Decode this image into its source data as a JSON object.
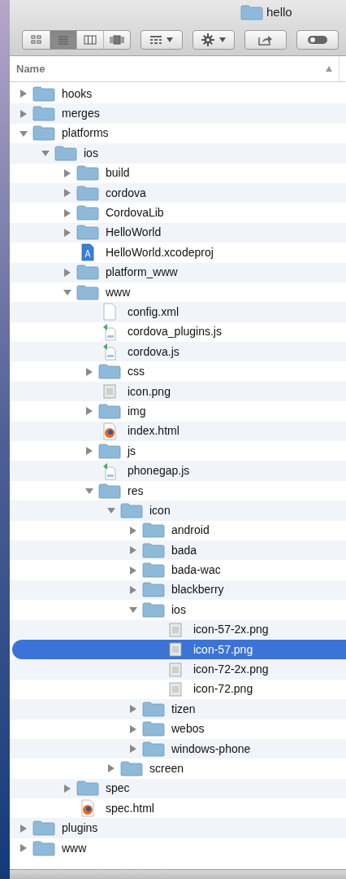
{
  "window": {
    "title": "hello"
  },
  "toolbar": {
    "view_modes": [
      {
        "kind": "icons",
        "selected": false
      },
      {
        "kind": "list",
        "selected": true
      },
      {
        "kind": "columns",
        "selected": false
      },
      {
        "kind": "coverflow",
        "selected": false
      }
    ]
  },
  "columns": [
    {
      "label": "Name",
      "sorted": true
    }
  ],
  "tree": [
    {
      "name": "hooks",
      "kind": "folder",
      "expanded": false,
      "selected": false
    },
    {
      "name": "merges",
      "kind": "folder",
      "expanded": false,
      "selected": false
    },
    {
      "name": "platforms",
      "kind": "folder",
      "expanded": true,
      "selected": false,
      "children": [
        {
          "name": "ios",
          "kind": "folder",
          "expanded": true,
          "selected": false,
          "children": [
            {
              "name": "build",
              "kind": "folder",
              "expanded": false,
              "selected": false
            },
            {
              "name": "cordova",
              "kind": "folder",
              "expanded": false,
              "selected": false
            },
            {
              "name": "CordovaLib",
              "kind": "folder",
              "expanded": false,
              "selected": false
            },
            {
              "name": "HelloWorld",
              "kind": "folder",
              "expanded": false,
              "selected": false
            },
            {
              "name": "HelloWorld.xcodeproj",
              "kind": "project",
              "selected": false
            },
            {
              "name": "platform_www",
              "kind": "folder",
              "expanded": false,
              "selected": false
            },
            {
              "name": "www",
              "kind": "folder",
              "expanded": true,
              "selected": false,
              "children": [
                {
                  "name": "config.xml",
                  "kind": "document",
                  "selected": false
                },
                {
                  "name": "cordova_plugins.js",
                  "kind": "script",
                  "selected": false
                },
                {
                  "name": "cordova.js",
                  "kind": "script",
                  "selected": false
                },
                {
                  "name": "css",
                  "kind": "folder",
                  "expanded": false,
                  "selected": false
                },
                {
                  "name": "icon.png",
                  "kind": "image",
                  "selected": false
                },
                {
                  "name": "img",
                  "kind": "folder",
                  "expanded": false,
                  "selected": false
                },
                {
                  "name": "index.html",
                  "kind": "html",
                  "selected": false
                },
                {
                  "name": "js",
                  "kind": "folder",
                  "expanded": false,
                  "selected": false
                },
                {
                  "name": "phonegap.js",
                  "kind": "script",
                  "selected": false
                },
                {
                  "name": "res",
                  "kind": "folder",
                  "expanded": true,
                  "selected": false,
                  "children": [
                    {
                      "name": "icon",
                      "kind": "folder",
                      "expanded": true,
                      "selected": false,
                      "children": [
                        {
                          "name": "android",
                          "kind": "folder",
                          "expanded": false,
                          "selected": false
                        },
                        {
                          "name": "bada",
                          "kind": "folder",
                          "expanded": false,
                          "selected": false
                        },
                        {
                          "name": "bada-wac",
                          "kind": "folder",
                          "expanded": false,
                          "selected": false
                        },
                        {
                          "name": "blackberry",
                          "kind": "folder",
                          "expanded": false,
                          "selected": false
                        },
                        {
                          "name": "ios",
                          "kind": "folder",
                          "expanded": true,
                          "selected": false,
                          "children": [
                            {
                              "name": "icon-57-2x.png",
                              "kind": "image",
                              "selected": false
                            },
                            {
                              "name": "icon-57.png",
                              "kind": "image",
                              "selected": true
                            },
                            {
                              "name": "icon-72-2x.png",
                              "kind": "image",
                              "selected": false
                            },
                            {
                              "name": "icon-72.png",
                              "kind": "image",
                              "selected": false
                            }
                          ]
                        },
                        {
                          "name": "tizen",
                          "kind": "folder",
                          "expanded": false,
                          "selected": false
                        },
                        {
                          "name": "webos",
                          "kind": "folder",
                          "expanded": false,
                          "selected": false
                        },
                        {
                          "name": "windows-phone",
                          "kind": "folder",
                          "expanded": false,
                          "selected": false
                        }
                      ]
                    },
                    {
                      "name": "screen",
                      "kind": "folder",
                      "expanded": false,
                      "selected": false
                    }
                  ]
                }
              ]
            },
            {
              "name": "spec",
              "kind": "folder",
              "expanded": false,
              "selected": false
            },
            {
              "name": "spec.html",
              "kind": "html",
              "selected": false
            }
          ]
        }
      ]
    },
    {
      "name": "plugins",
      "kind": "folder",
      "expanded": false,
      "selected": false
    },
    {
      "name": "www",
      "kind": "folder",
      "expanded": false,
      "selected": false
    }
  ]
}
